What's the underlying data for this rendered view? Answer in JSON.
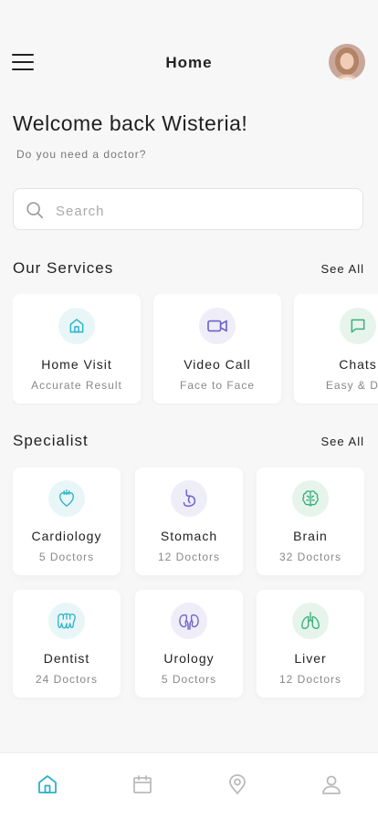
{
  "header": {
    "title": "Home"
  },
  "welcome": {
    "heading": "Welcome back Wisteria!",
    "subtitle": "Do you need a doctor?"
  },
  "search": {
    "placeholder": "Search",
    "value": ""
  },
  "services": {
    "title": "Our Services",
    "see_all": "See All",
    "items": [
      {
        "title": "Home Visit",
        "subtitle": "Accurate Result",
        "icon": "home-icon",
        "color": "#2bb3c9",
        "bg": "#e8f6f8"
      },
      {
        "title": "Video Call",
        "subtitle": "Face to Face",
        "icon": "video-icon",
        "color": "#6c63c7",
        "bg": "#eeedf8"
      },
      {
        "title": "Chats",
        "subtitle": "Easy & Diff",
        "icon": "chat-icon",
        "color": "#3db07a",
        "bg": "#e6f4ec"
      }
    ]
  },
  "specialist": {
    "title": "Specialist",
    "see_all": "See All",
    "items": [
      {
        "title": "Cardiology",
        "subtitle": "5 Doctors",
        "icon": "heart-icon",
        "color": "#2bb3c9",
        "bg": "#e8f6f8"
      },
      {
        "title": "Stomach",
        "subtitle": "12 Doctors",
        "icon": "stomach-icon",
        "color": "#6c63c7",
        "bg": "#eeedf8"
      },
      {
        "title": "Brain",
        "subtitle": "32 Doctors",
        "icon": "brain-icon",
        "color": "#3db07a",
        "bg": "#e6f4ec"
      },
      {
        "title": "Dentist",
        "subtitle": "24 Doctors",
        "icon": "tooth-icon",
        "color": "#2bb3c9",
        "bg": "#e8f6f8"
      },
      {
        "title": "Urology",
        "subtitle": "5 Doctors",
        "icon": "kidney-icon",
        "color": "#6c63c7",
        "bg": "#eeedf8"
      },
      {
        "title": "Liver",
        "subtitle": "12 Doctors",
        "icon": "lungs-icon",
        "color": "#3db07a",
        "bg": "#e6f4ec"
      }
    ]
  },
  "tabbar": {
    "active_color": "#2bb3c9",
    "inactive_color": "#bbbbbb",
    "items": [
      {
        "icon": "home-icon",
        "active": true
      },
      {
        "icon": "calendar-icon",
        "active": false
      },
      {
        "icon": "location-pin-icon",
        "active": false
      },
      {
        "icon": "profile-icon",
        "active": false
      }
    ]
  }
}
